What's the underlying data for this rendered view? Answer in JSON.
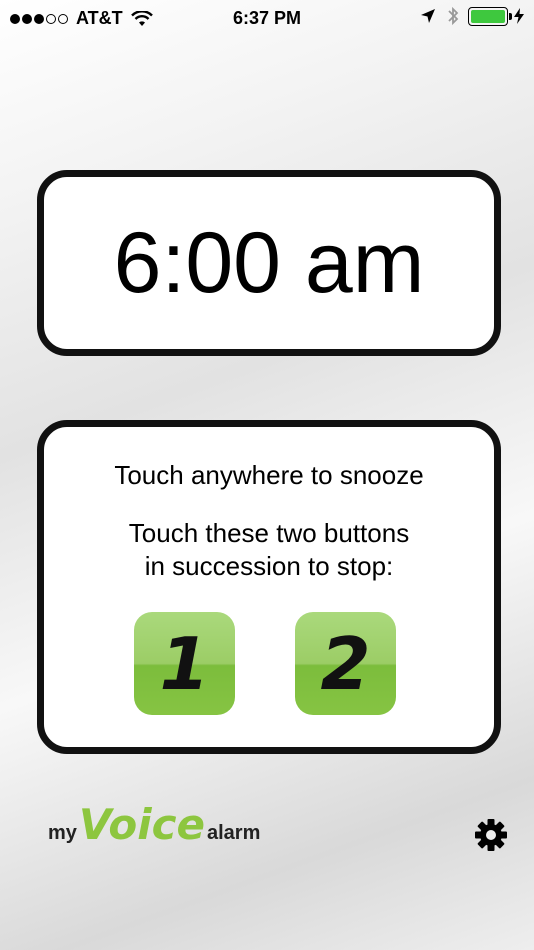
{
  "status_bar": {
    "carrier": "AT&T",
    "time": "6:37 PM",
    "battery_percent": 100
  },
  "alarm": {
    "time": "6:00 am",
    "snooze_instruction": "Touch anywhere to snooze",
    "stop_instruction_line1": "Touch these two buttons",
    "stop_instruction_line2": "in succession to stop:",
    "button1_label": "1",
    "button2_label": "2"
  },
  "logo": {
    "my": "my",
    "voice": "Voice",
    "alarm": "alarm",
    "accent_color": "#8dc63f"
  },
  "icons": [
    "wifi-icon",
    "location-arrow-icon",
    "bluetooth-icon",
    "battery-icon",
    "charging-icon",
    "gear-icon"
  ]
}
